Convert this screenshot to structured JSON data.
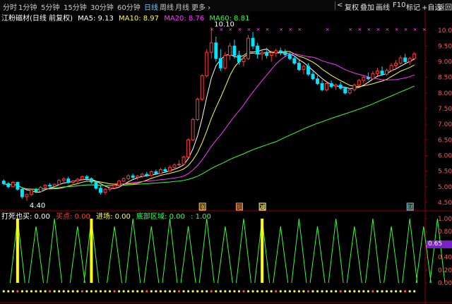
{
  "toolbar": {
    "period_tabs": [
      "分时",
      "1分钟",
      "5分钟",
      "15分钟",
      "30分钟",
      "60分钟",
      "日线",
      "周线",
      "月线",
      "更多 ›"
    ],
    "active_tab": "日线",
    "right_buttons": [
      "复权",
      "叠加",
      "画线",
      "F10",
      "标记",
      "+自选",
      "返回"
    ],
    "nav_left": "<",
    "nav_right": ">"
  },
  "info": {
    "stock": "江粉磁材(日线 前复权)",
    "ma5": "MA5: 9.13",
    "ma10": "MA10: 8.97",
    "ma20": "MA20: 8.76",
    "ma60": "MA60: 8.81"
  },
  "colors": {
    "up": "#ff3b3b",
    "down": "#00e5ff",
    "ma5": "#ffffff",
    "ma10": "#ffff33",
    "ma20": "#ff33ff",
    "ma60": "#33ff33",
    "axis": "#8a0000",
    "marker": "#ff55ff"
  },
  "price_axis": {
    "ticks": [
      "10.00",
      "9.50",
      "9.00",
      "8.50",
      "8.00",
      "7.50",
      "7.00",
      "6.50",
      "6.00",
      "5.50",
      "5.00",
      "4.50"
    ],
    "min": 4.25,
    "max": 10.25
  },
  "annotations": {
    "high": "10.10",
    "low": "4.40"
  },
  "signal_marks": [
    "涨",
    "阳",
    "减",
    "财"
  ],
  "indicator": {
    "name": "打死也买",
    "name_value": ": 0.00",
    "buy_label": "买点: 0.00",
    "enter_label": "进场: 0.00",
    "bottom_label": "底部区域: 0.00",
    "extra_label": ": 1.00",
    "ticks": [
      "1.00",
      "0.80",
      "0.60",
      "0.40",
      "0.20",
      "0.00"
    ],
    "current_value": "0.65"
  },
  "chart_data": {
    "type": "candlestick",
    "ohlc": [
      [
        5.18,
        5.24,
        5.05,
        5.1
      ],
      [
        5.1,
        5.15,
        4.95,
        5.0
      ],
      [
        5.0,
        5.18,
        4.98,
        5.14
      ],
      [
        5.14,
        5.16,
        4.88,
        4.92
      ],
      [
        4.92,
        4.98,
        4.62,
        4.68
      ],
      [
        4.68,
        4.78,
        4.55,
        4.75
      ],
      [
        4.75,
        4.92,
        4.72,
        4.9
      ],
      [
        4.9,
        4.96,
        4.8,
        4.85
      ],
      [
        4.85,
        5.02,
        4.82,
        4.98
      ],
      [
        4.98,
        5.08,
        4.92,
        5.05
      ],
      [
        5.05,
        5.12,
        4.98,
        5.02
      ],
      [
        5.02,
        5.1,
        4.95,
        5.08
      ],
      [
        5.08,
        5.25,
        5.05,
        5.2
      ],
      [
        5.2,
        5.3,
        5.15,
        5.25
      ],
      [
        5.25,
        5.32,
        5.1,
        5.14
      ],
      [
        5.14,
        5.22,
        5.05,
        5.18
      ],
      [
        5.18,
        5.28,
        5.12,
        5.24
      ],
      [
        5.24,
        5.36,
        5.2,
        5.32
      ],
      [
        5.32,
        5.38,
        5.2,
        5.26
      ],
      [
        5.26,
        5.3,
        5.1,
        5.15
      ],
      [
        5.15,
        5.2,
        4.9,
        4.95
      ],
      [
        4.95,
        5.05,
        4.75,
        4.82
      ],
      [
        4.82,
        4.95,
        4.75,
        4.92
      ],
      [
        4.92,
        5.0,
        4.85,
        4.96
      ],
      [
        4.96,
        5.08,
        4.92,
        5.05
      ],
      [
        5.05,
        5.22,
        5.02,
        5.18
      ],
      [
        5.18,
        5.3,
        5.14,
        5.26
      ],
      [
        5.26,
        5.4,
        5.22,
        5.35
      ],
      [
        5.35,
        5.42,
        5.25,
        5.3
      ],
      [
        5.3,
        5.38,
        5.22,
        5.34
      ],
      [
        5.34,
        5.44,
        5.28,
        5.4
      ],
      [
        5.4,
        5.48,
        5.32,
        5.36
      ],
      [
        5.36,
        5.52,
        5.34,
        5.48
      ],
      [
        5.48,
        5.55,
        5.38,
        5.42
      ],
      [
        5.42,
        5.6,
        5.4,
        5.55
      ],
      [
        5.55,
        5.62,
        5.45,
        5.5
      ],
      [
        5.5,
        5.68,
        5.48,
        5.62
      ],
      [
        5.62,
        5.75,
        5.55,
        5.7
      ],
      [
        5.7,
        5.85,
        5.65,
        5.72
      ],
      [
        5.72,
        6.0,
        5.7,
        5.95
      ],
      [
        5.95,
        6.55,
        5.92,
        6.5
      ],
      [
        6.5,
        7.2,
        6.45,
        7.15
      ],
      [
        7.15,
        7.85,
        7.1,
        7.8
      ],
      [
        7.8,
        8.6,
        7.75,
        8.55
      ],
      [
        8.55,
        9.4,
        8.5,
        9.3
      ],
      [
        9.3,
        10.1,
        9.1,
        9.6
      ],
      [
        9.6,
        9.8,
        9.0,
        9.1
      ],
      [
        9.1,
        9.4,
        8.7,
        8.8
      ],
      [
        8.8,
        9.3,
        8.75,
        9.2
      ],
      [
        9.2,
        9.6,
        9.05,
        9.5
      ],
      [
        9.5,
        9.7,
        9.1,
        9.2
      ],
      [
        9.2,
        9.35,
        8.9,
        9.0
      ],
      [
        9.0,
        9.2,
        8.85,
        9.1
      ],
      [
        9.1,
        9.85,
        9.05,
        9.75
      ],
      [
        9.75,
        9.95,
        9.4,
        9.5
      ],
      [
        9.5,
        9.6,
        9.1,
        9.25
      ],
      [
        9.25,
        9.4,
        9.05,
        9.3
      ],
      [
        9.3,
        9.45,
        9.1,
        9.2
      ],
      [
        9.2,
        9.35,
        9.0,
        9.28
      ],
      [
        9.28,
        9.42,
        9.15,
        9.35
      ],
      [
        9.35,
        9.45,
        9.2,
        9.3
      ],
      [
        9.3,
        9.4,
        9.15,
        9.22
      ],
      [
        9.22,
        9.3,
        9.05,
        9.1
      ],
      [
        9.1,
        9.2,
        8.9,
        8.95
      ],
      [
        8.95,
        9.05,
        8.7,
        8.75
      ],
      [
        8.75,
        8.9,
        8.6,
        8.85
      ],
      [
        8.85,
        8.95,
        8.55,
        8.6
      ],
      [
        8.6,
        8.7,
        8.4,
        8.45
      ],
      [
        8.45,
        8.55,
        8.25,
        8.3
      ],
      [
        8.3,
        8.4,
        8.05,
        8.1
      ],
      [
        8.1,
        8.35,
        8.05,
        8.3
      ],
      [
        8.3,
        8.4,
        8.15,
        8.2
      ],
      [
        8.2,
        8.3,
        8.1,
        8.25
      ],
      [
        8.25,
        8.35,
        8.1,
        8.15
      ],
      [
        8.15,
        8.2,
        7.95,
        8.0
      ],
      [
        8.0,
        8.15,
        7.95,
        8.1
      ],
      [
        8.1,
        8.3,
        8.05,
        8.25
      ],
      [
        8.25,
        8.45,
        8.2,
        8.4
      ],
      [
        8.4,
        8.55,
        8.3,
        8.5
      ],
      [
        8.5,
        8.65,
        8.4,
        8.45
      ],
      [
        8.45,
        8.7,
        8.42,
        8.62
      ],
      [
        8.62,
        8.8,
        8.55,
        8.7
      ],
      [
        8.7,
        8.85,
        8.55,
        8.6
      ],
      [
        8.6,
        8.78,
        8.55,
        8.72
      ],
      [
        8.72,
        8.95,
        8.68,
        8.88
      ],
      [
        8.88,
        9.05,
        8.8,
        8.95
      ],
      [
        8.95,
        9.2,
        8.9,
        9.12
      ],
      [
        9.12,
        9.25,
        8.95,
        9.0
      ],
      [
        9.0,
        9.15,
        8.9,
        9.1
      ],
      [
        9.1,
        9.3,
        9.05,
        9.25
      ]
    ],
    "spikes": [
      {
        "i": 3,
        "v": 1.0,
        "c": "#ffff00"
      },
      {
        "i": 7,
        "v": 0.88
      },
      {
        "i": 11,
        "v": 1.0
      },
      {
        "i": 16,
        "v": 0.88
      },
      {
        "i": 19,
        "v": 1.0,
        "c": "#ffff00"
      },
      {
        "i": 24,
        "v": 0.88
      },
      {
        "i": 28,
        "v": 1.0
      },
      {
        "i": 32,
        "v": 0.88
      },
      {
        "i": 36,
        "v": 1.0
      },
      {
        "i": 40,
        "v": 0.88
      },
      {
        "i": 44,
        "v": 1.0
      },
      {
        "i": 48,
        "v": 0.88
      },
      {
        "i": 52,
        "v": 1.0
      },
      {
        "i": 56,
        "v": 1.0,
        "c": "#ffff00"
      },
      {
        "i": 60,
        "v": 0.88
      },
      {
        "i": 64,
        "v": 1.0
      },
      {
        "i": 68,
        "v": 0.88
      },
      {
        "i": 72,
        "v": 1.0
      },
      {
        "i": 76,
        "v": 0.88
      },
      {
        "i": 80,
        "v": 1.0
      },
      {
        "i": 84,
        "v": 0.88
      },
      {
        "i": 88,
        "v": 1.0
      },
      {
        "i": 91,
        "v": 0.88
      },
      {
        "i": 94,
        "v": 1.0
      }
    ]
  }
}
